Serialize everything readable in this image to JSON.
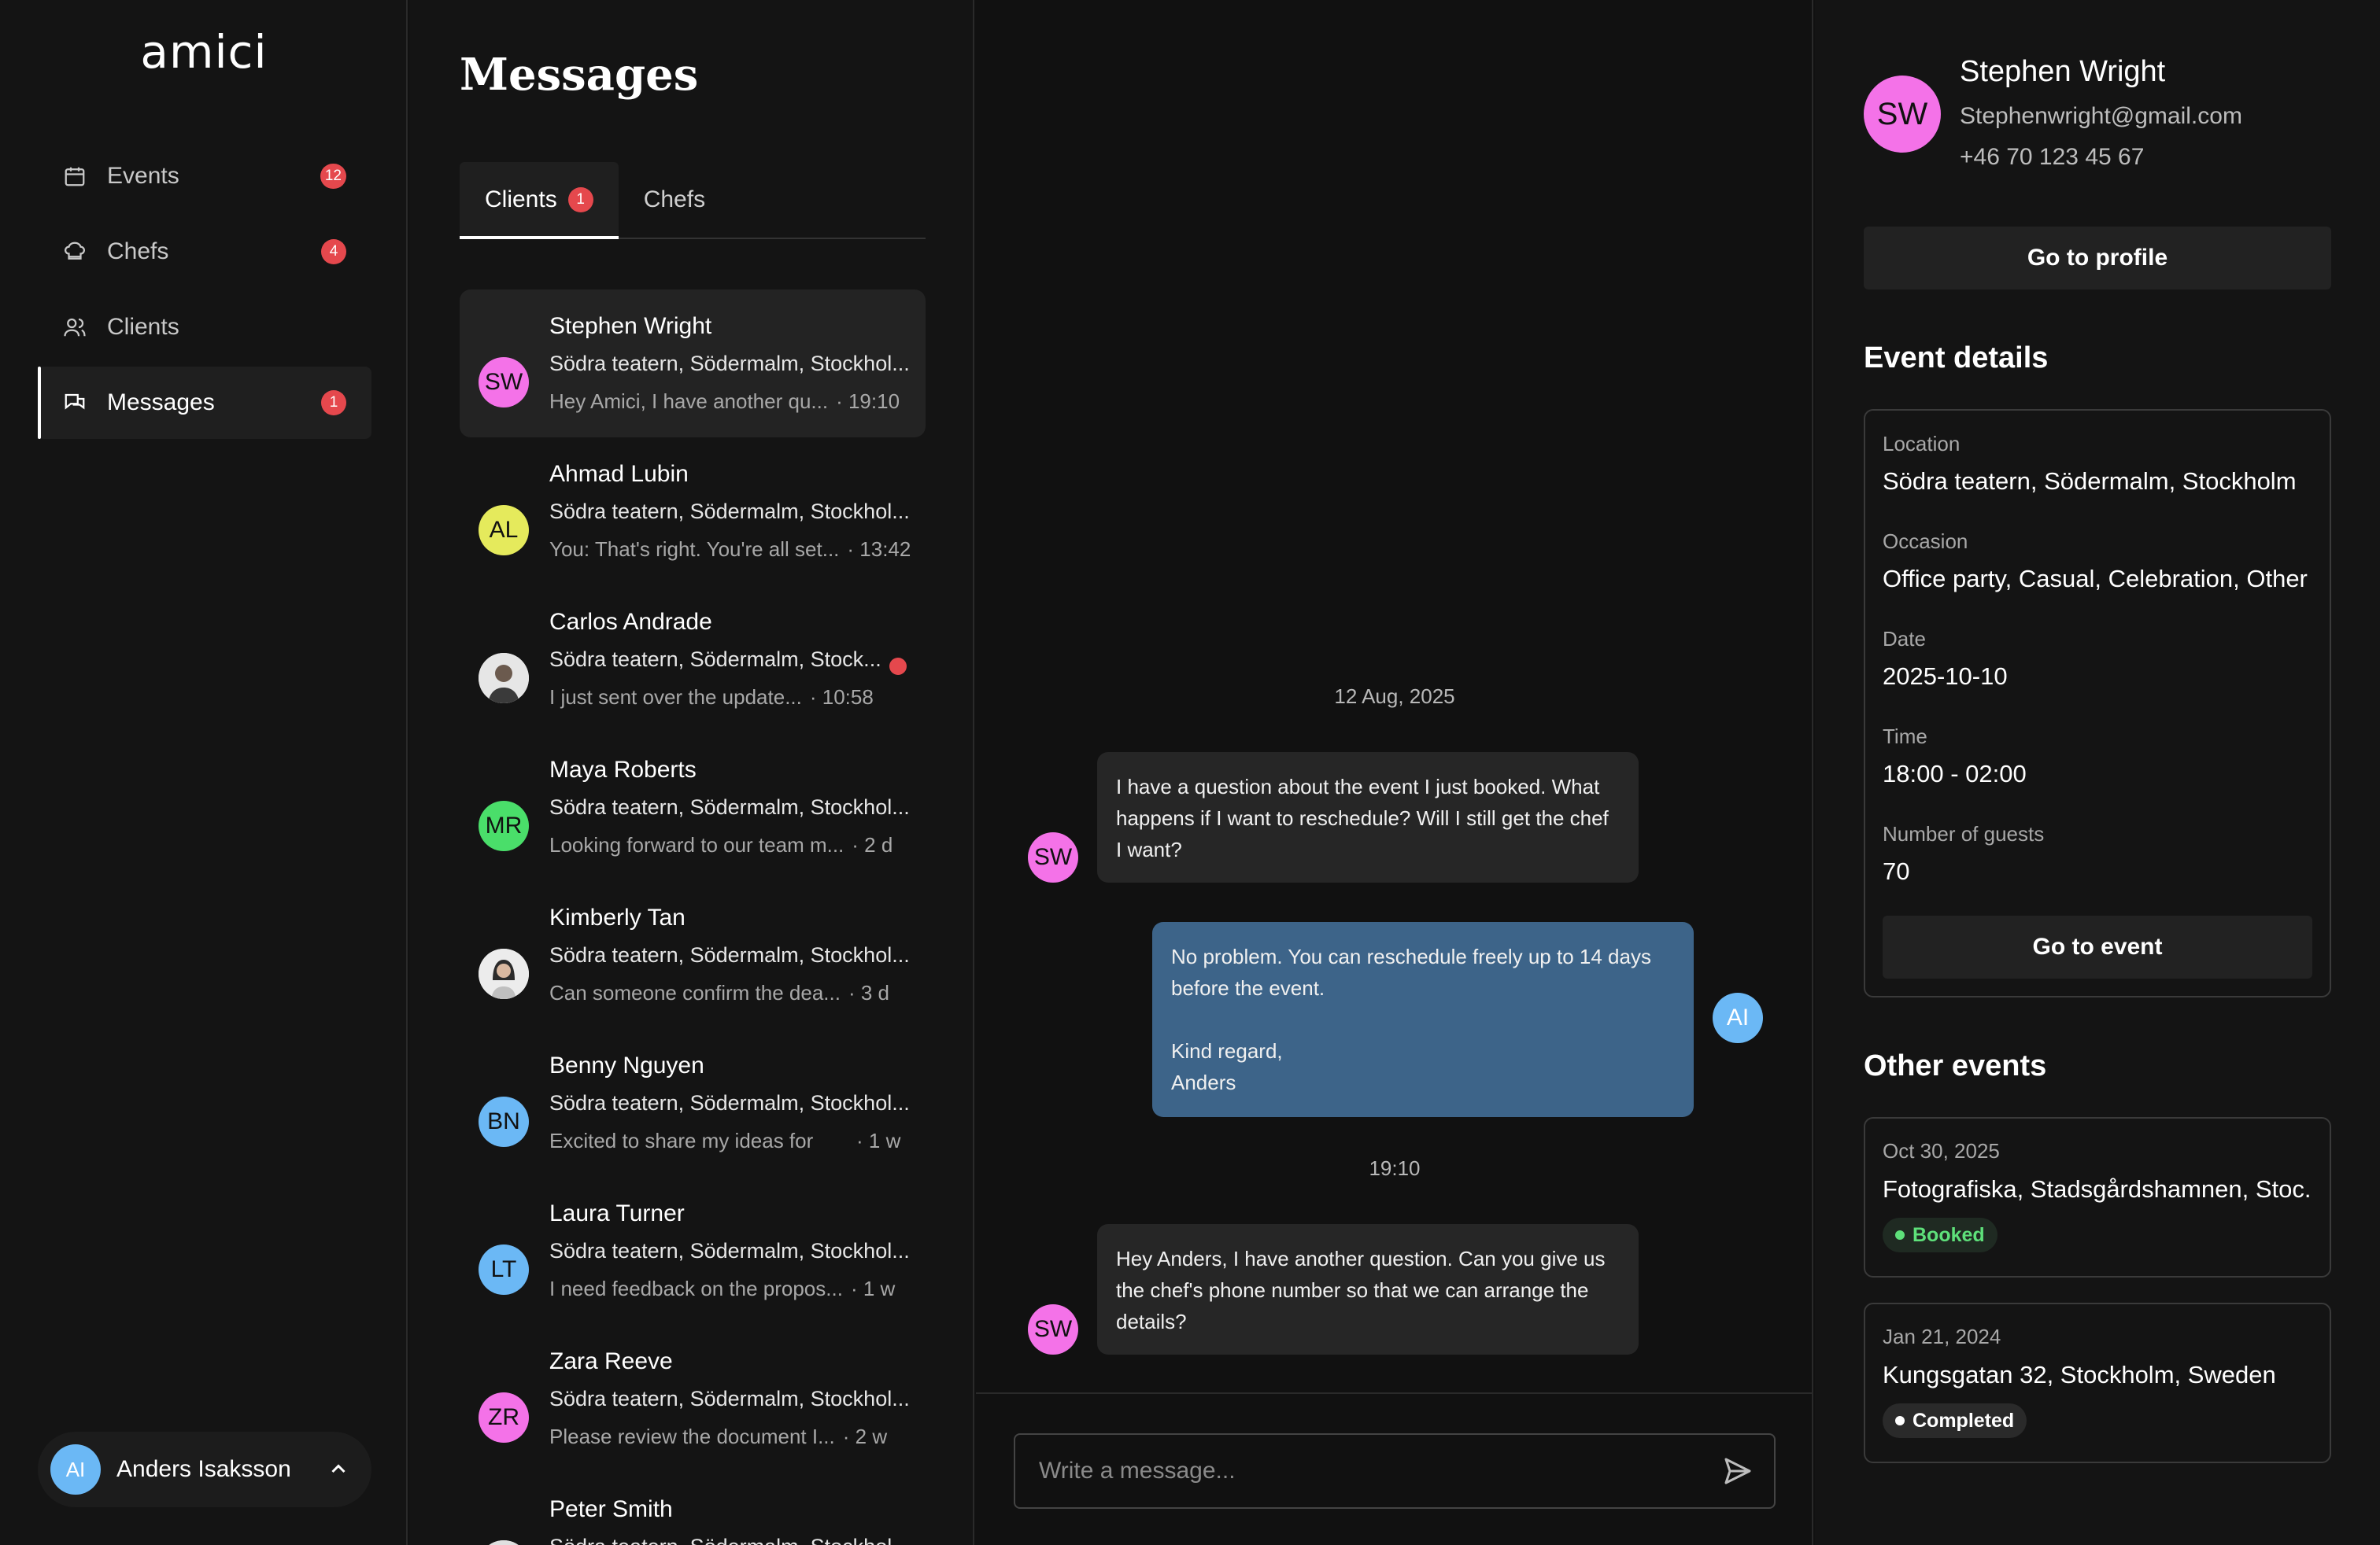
{
  "app": {
    "logo": "amici"
  },
  "sidebar": {
    "items": [
      {
        "label": "Events",
        "badge": "12",
        "icon": "calendar-icon"
      },
      {
        "label": "Chefs",
        "badge": "4",
        "icon": "chef-hat-icon"
      },
      {
        "label": "Clients",
        "badge": "",
        "icon": "users-icon"
      },
      {
        "label": "Messages",
        "badge": "1",
        "icon": "messages-icon",
        "active": true
      }
    ],
    "user": {
      "initials": "AI",
      "name": "Anders Isaksson"
    }
  },
  "messages": {
    "title": "Messages",
    "tabs": [
      {
        "label": "Clients",
        "badge": "1"
      },
      {
        "label": "Chefs",
        "badge": ""
      }
    ],
    "conversations": [
      {
        "initials": "SW",
        "color": "#f472e8",
        "name": "Stephen Wright",
        "location": "Södra teatern, Södermalm, Stockhol...",
        "preview": "Hey Amici, I have another qu...",
        "time": "· 19:10"
      },
      {
        "initials": "AL",
        "color": "#e5ea5c",
        "name": "Ahmad Lubin",
        "location": "Södra teatern, Södermalm, Stockhol...",
        "preview": "You: That's right. You're all set...",
        "time": "· 13:42"
      },
      {
        "initials": "",
        "color": "#d8d8d8",
        "name": "Carlos Andrade",
        "location": "Södra teatern, Södermalm, Stock...",
        "preview": "I just sent over the update...",
        "time": "· 10:58",
        "unread": true
      },
      {
        "initials": "MR",
        "color": "#4ade6a",
        "name": "Maya Roberts",
        "location": "Södra teatern, Södermalm, Stockhol...",
        "preview": "Looking forward to our team m...",
        "time": "· 2 d"
      },
      {
        "initials": "",
        "color": "#d8d8d8",
        "name": "Kimberly Tan",
        "location": "Södra teatern, Södermalm, Stockhol...",
        "preview": "Can someone confirm the dea...",
        "time": "· 3 d"
      },
      {
        "initials": "BN",
        "color": "#6bb8f5",
        "name": "Benny Nguyen",
        "location": "Södra teatern, Södermalm, Stockhol...",
        "preview": "Excited to share my ideas for",
        "time": "· 1 w"
      },
      {
        "initials": "LT",
        "color": "#6bb8f5",
        "name": "Laura Turner",
        "location": "Södra teatern, Södermalm, Stockhol...",
        "preview": "I need feedback on the propos...",
        "time": "· 1 w"
      },
      {
        "initials": "ZR",
        "color": "#f472e8",
        "name": "Zara Reeve",
        "location": "Södra teatern, Södermalm, Stockhol...",
        "preview": "Please review the document I...",
        "time": "· 2 w"
      },
      {
        "initials": "",
        "color": "#d8d8d8",
        "name": "Peter Smith",
        "location": "Södra teatern, Södermalm, Stockhol...",
        "preview": "",
        "time": ""
      }
    ]
  },
  "chat": {
    "date_separator": "12 Aug, 2025",
    "time_separator": "19:10",
    "messages": [
      {
        "from": "SW",
        "direction": "in",
        "text": "I have a question about the event I just booked. What happens if I want to reschedule? Will I still get the chef I want?"
      },
      {
        "from": "AI",
        "direction": "out",
        "text": "No problem. You can reschedule freely up to 14 days before the event.\n\nKind regard,\nAnders"
      },
      {
        "from": "SW",
        "direction": "in",
        "text": "Hey Anders, I have another question. Can you give us the chef's phone number so that we can arrange the details?"
      }
    ],
    "composer": {
      "placeholder": "Write a message..."
    }
  },
  "details": {
    "contact": {
      "initials": "SW",
      "name": "Stephen Wright",
      "email": "Stephenwright@gmail.com",
      "phone": "+46 70 123 45 67"
    },
    "profile_button": "Go to profile",
    "event_title": "Event details",
    "fields": [
      {
        "label": "Location",
        "value": "Södra teatern, Södermalm, Stockholm"
      },
      {
        "label": "Occasion",
        "value": "Office party, Casual, Celebration, Other"
      },
      {
        "label": "Date",
        "value": "2025-10-10"
      },
      {
        "label": "Time",
        "value": "18:00 - 02:00"
      },
      {
        "label": "Number of guests",
        "value": "70"
      }
    ],
    "event_button": "Go to event",
    "other_title": "Other events",
    "other_events": [
      {
        "date": "Oct 30, 2025",
        "location": "Fotografiska, Stadsgårdshamnen, Stoc...",
        "status": "Booked"
      },
      {
        "date": "Jan 21, 2024",
        "location": "Kungsgatan 32, Stockholm, Sweden",
        "status": "Completed"
      }
    ]
  },
  "colors": {
    "accent_blue": "#3d6489",
    "badge_red": "#e5484d",
    "booked_green": "#5ee07a",
    "avatar_pink": "#f472e8",
    "avatar_blue": "#6bb8f5"
  }
}
